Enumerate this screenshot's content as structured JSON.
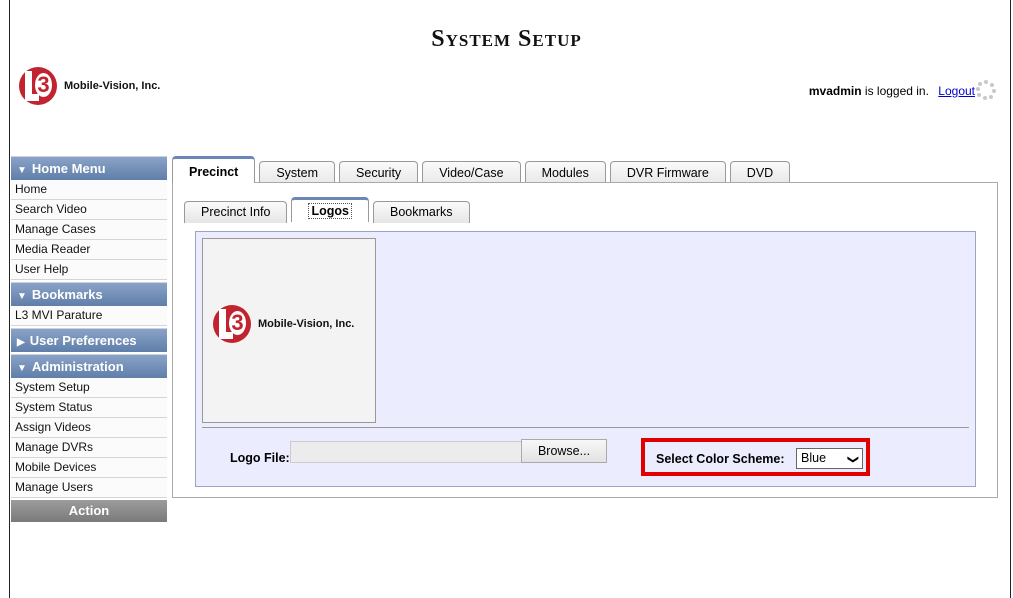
{
  "page_title": "System Setup",
  "logo": {
    "company": "Mobile-Vision, Inc."
  },
  "header": {
    "user": "mvadmin",
    "logged_in_text": " is logged in.",
    "logout": "Logout"
  },
  "sidebar": {
    "home_menu": {
      "label": "Home Menu",
      "items": [
        "Home",
        "Search Video",
        "Manage Cases",
        "Media Reader",
        "User Help"
      ]
    },
    "bookmarks": {
      "label": "Bookmarks",
      "items": [
        "L3 MVI Parature"
      ]
    },
    "user_preferences": {
      "label": "User Preferences"
    },
    "administration": {
      "label": "Administration",
      "items": [
        "System Setup",
        "System Status",
        "Assign Videos",
        "Manage DVRs",
        "Mobile Devices",
        "Manage Users"
      ]
    },
    "action": {
      "label": "Action"
    }
  },
  "tabs": [
    "Precinct",
    "System",
    "Security",
    "Video/Case",
    "Modules",
    "DVR Firmware",
    "DVD"
  ],
  "active_tab": "Precinct",
  "subtabs": [
    "Precinct Info",
    "Logos",
    "Bookmarks"
  ],
  "active_subtab": "Logos",
  "logos": {
    "logo_file_label": "Logo File:",
    "logo_file_value": "",
    "browse_label": "Browse...",
    "color_scheme_label": "Select Color Scheme:",
    "color_scheme_value": "Blue"
  },
  "colors": {
    "accent": "#6b87b5",
    "brand_red": "#c1232f",
    "highlight_red": "#e00000",
    "panel_bg": "#ececff"
  }
}
